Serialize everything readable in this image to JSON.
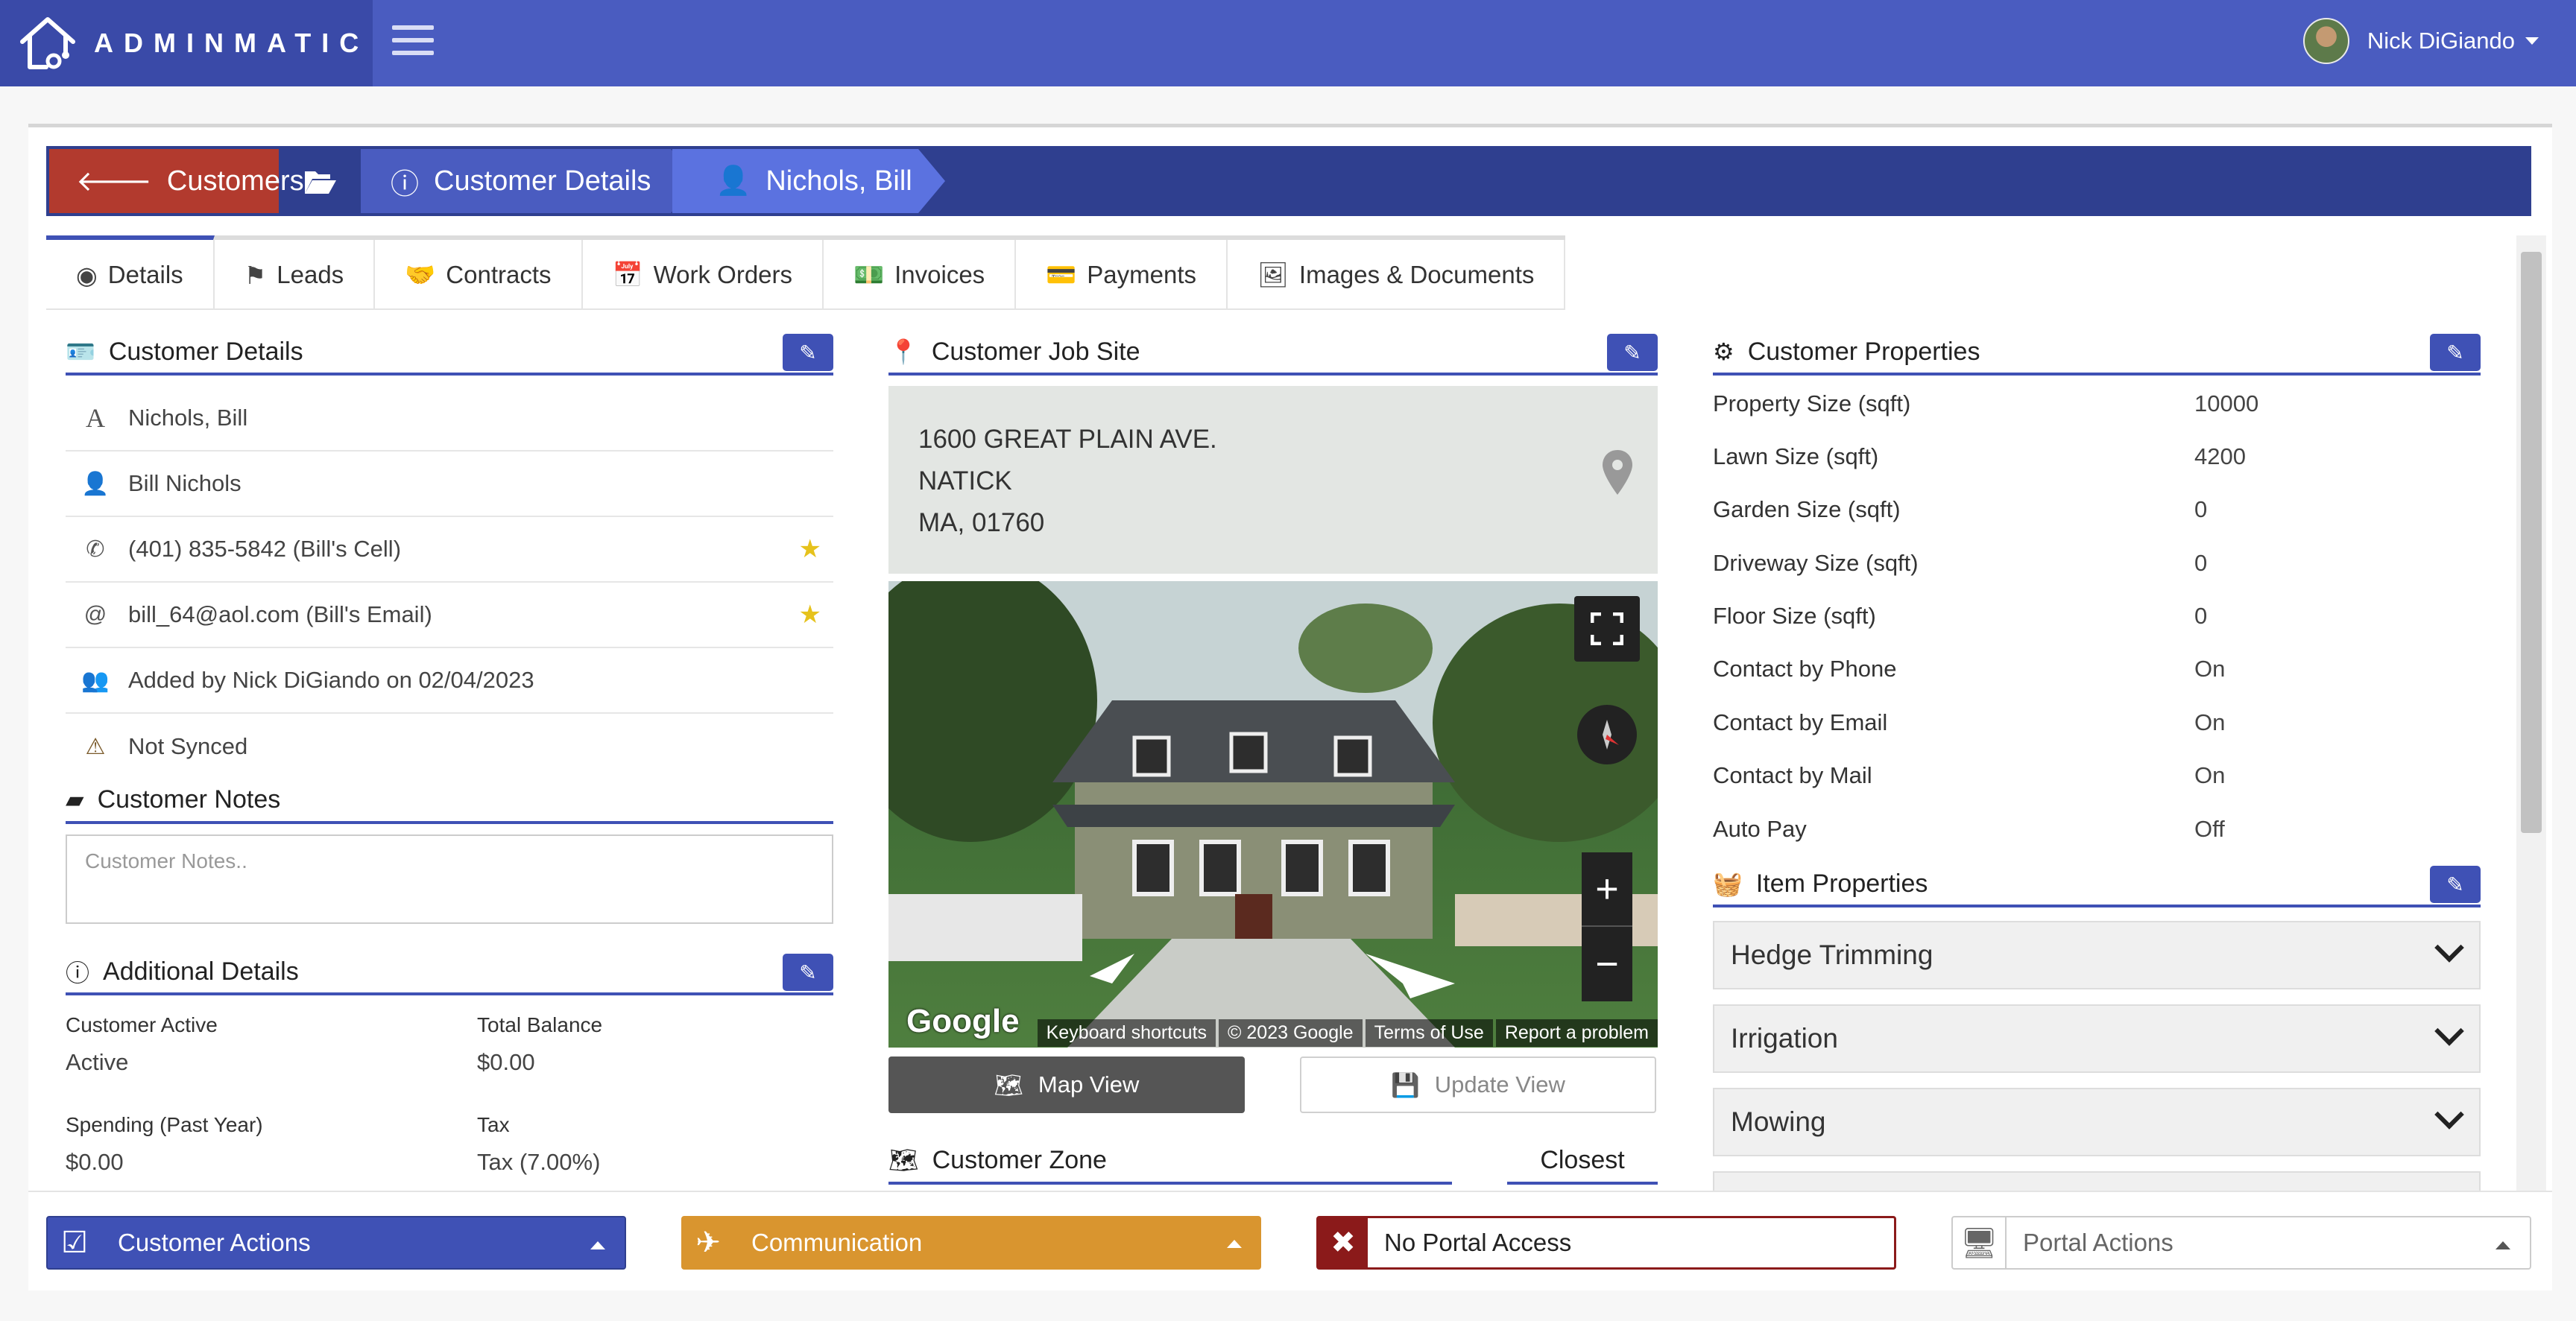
{
  "app": {
    "logo_text": "ADMINMATIC"
  },
  "user": {
    "name": "Nick DiGiando"
  },
  "breadcrumb": {
    "customers": "Customers",
    "details": "Customer Details",
    "name": "Nichols, Bill"
  },
  "tabs": [
    "Details",
    "Leads",
    "Contracts",
    "Work Orders",
    "Invoices",
    "Payments",
    "Images & Documents"
  ],
  "customer_details": {
    "title": "Customer Details",
    "rows": [
      "Nichols, Bill",
      "Bill Nichols",
      "(401) 835-5842 (Bill's Cell)",
      "bill_64@aol.com (Bill's Email)",
      "Added by Nick DiGiando on 02/04/2023",
      "Not Synced"
    ]
  },
  "customer_notes": {
    "title": "Customer Notes",
    "placeholder": "Customer Notes.."
  },
  "additional_details": {
    "title": "Additional Details",
    "customer_active_label": "Customer Active",
    "customer_active_value": "Active",
    "total_balance_label": "Total Balance",
    "total_balance_value": "$0.00",
    "spending_label": "Spending (Past Year)",
    "spending_value": "$0.00",
    "tax_label": "Tax",
    "tax_value": "Tax (7.00%)"
  },
  "job_site": {
    "title": "Customer Job Site",
    "address_line1": "1600 GREAT PLAIN AVE.",
    "address_line2": "NATICK",
    "address_line3": "MA, 01760",
    "map_view": "Map View",
    "update_view": "Update View",
    "footer": {
      "google": "Google",
      "shortcuts": "Keyboard shortcuts",
      "copyright": "© 2023 Google",
      "terms": "Terms of Use",
      "report": "Report a problem"
    }
  },
  "customer_zone": {
    "title": "Customer Zone",
    "closest": "Closest"
  },
  "properties": {
    "title": "Customer Properties",
    "rows": [
      {
        "label": "Property Size (sqft)",
        "value": "10000"
      },
      {
        "label": "Lawn Size (sqft)",
        "value": "4200"
      },
      {
        "label": "Garden Size (sqft)",
        "value": "0"
      },
      {
        "label": "Driveway Size (sqft)",
        "value": "0"
      },
      {
        "label": "Floor Size (sqft)",
        "value": "0"
      },
      {
        "label": "Contact by Phone",
        "value": "On"
      },
      {
        "label": "Contact by Email",
        "value": "On"
      },
      {
        "label": "Contact by Mail",
        "value": "On"
      },
      {
        "label": "Auto Pay",
        "value": "Off"
      }
    ]
  },
  "item_properties": {
    "title": "Item Properties",
    "items": [
      "Hedge Trimming",
      "Irrigation",
      "Mowing"
    ]
  },
  "footer_actions": {
    "customer_actions": "Customer Actions",
    "communication": "Communication",
    "portal_access": "No Portal Access",
    "portal_actions": "Portal Actions"
  },
  "colors": {
    "primary": "#3f51b5",
    "topbar": "#4a5cc0",
    "breadcrumb_bg": "#2f3f8f",
    "customers_btn": "#b23a2e",
    "communication": "#d9952f",
    "portal_danger": "#8b1a1a",
    "star": "#e6c21c"
  }
}
